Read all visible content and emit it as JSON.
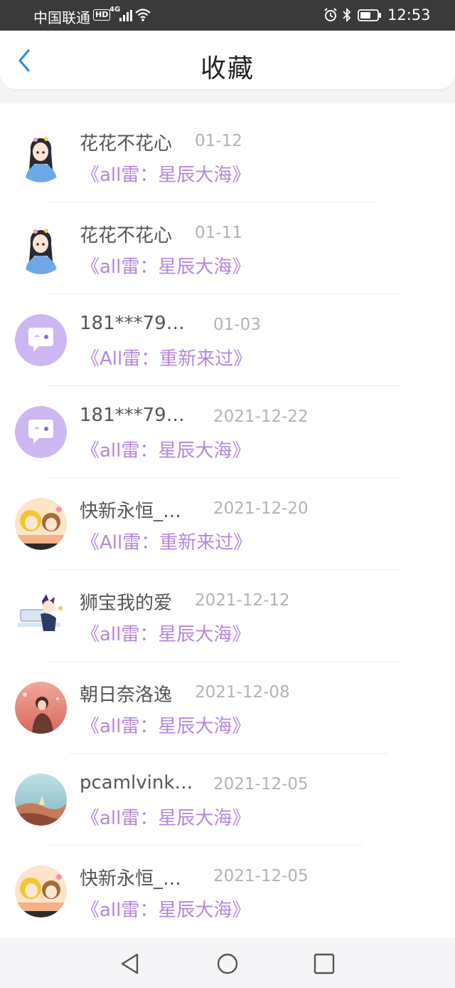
{
  "status_bar": {
    "carrier": "中国联通",
    "hd": "HD",
    "network": "4G",
    "time": "12:53",
    "icons": [
      "signal-icon",
      "wifi-icon",
      "alarm-icon",
      "bluetooth-icon",
      "battery-icon"
    ]
  },
  "header": {
    "title": "收藏",
    "back_icon": "chevron-left-icon",
    "accent_color": "#2a8ee6"
  },
  "items": [
    {
      "name": "花花不花心",
      "date": "01-12",
      "book": "《all雷：星辰大海》",
      "avatar": "anime-girl-avatar"
    },
    {
      "name": "花花不花心",
      "date": "01-11",
      "book": "《all雷：星辰大海》",
      "avatar": "anime-girl-avatar"
    },
    {
      "name": "181***79…",
      "date": "01-03",
      "book": "《All雷：重新来过》",
      "avatar": "default-chat-avatar"
    },
    {
      "name": "181***79…",
      "date": "2021-12-22",
      "book": "《all雷：星辰大海》",
      "avatar": "default-chat-avatar"
    },
    {
      "name": "快新永恒_…",
      "date": "2021-12-20",
      "book": "《All雷：重新来过》",
      "avatar": "anime-duo-avatar"
    },
    {
      "name": "狮宝我的爱",
      "date": "2021-12-12",
      "book": "《all雷：星辰大海》",
      "avatar": "anime-boy-avatar"
    },
    {
      "name": "朝日奈洛逸",
      "date": "2021-12-08",
      "book": "《all雷：星辰大海》",
      "avatar": "illustration-avatar"
    },
    {
      "name": "pcamlvink…",
      "date": "2021-12-05",
      "book": "《all雷：星辰大海》",
      "avatar": "landscape-avatar"
    },
    {
      "name": "快新永恒_…",
      "date": "2021-12-05",
      "book": "《all雷：星辰大海》",
      "avatar": "anime-duo-avatar"
    }
  ],
  "colors": {
    "book_title": "#b587d9",
    "date": "#b3b3b3",
    "name": "#555555",
    "default_avatar_bg": "#cdb7f3"
  },
  "nav_bar": {
    "buttons": [
      "back-triangle-icon",
      "home-circle-icon",
      "recents-square-icon"
    ]
  }
}
